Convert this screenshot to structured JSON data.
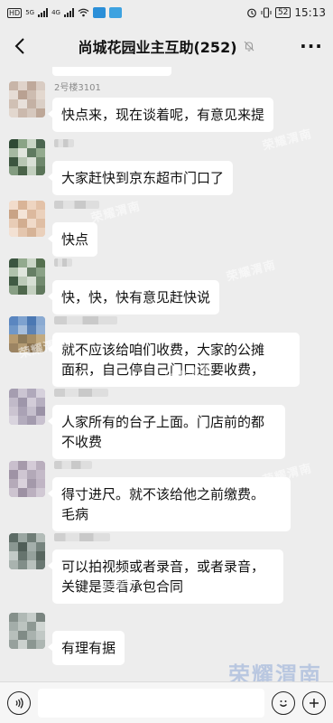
{
  "status_bar": {
    "left_text": "HD",
    "signal_labels": [
      "5G",
      "4G"
    ],
    "time": "15:13",
    "battery": "52"
  },
  "header": {
    "title": "尚城花园业主互助(252)",
    "back_icon": "chevron-left-icon",
    "mute_icon": "bell-off-icon",
    "more_label": "···"
  },
  "messages": [
    {
      "sender": "2号楼3101",
      "text": "快点来，现在谈着呢，有意见来提"
    },
    {
      "sender": "",
      "text": "大家赶快到京东超市门口了"
    },
    {
      "sender": "",
      "text": "快点"
    },
    {
      "sender": "",
      "text": "快，快，快有意见赶快说"
    },
    {
      "sender": "",
      "text": "就不应该给咱们收费，大家的公摊\n面积，自己停自己门口还要收费，"
    },
    {
      "sender": "",
      "text": "人家所有的台子上面。门店前的都\n不收费"
    },
    {
      "sender": "",
      "text": "得寸进尺。就不该给他之前缴费。\n毛病"
    },
    {
      "sender": "",
      "text": "可以拍视频或者录音，或者录音，\n关键是要看承包合同"
    },
    {
      "sender": "",
      "text": "有理有据"
    }
  ],
  "watermark": "荣耀渭南",
  "input_bar": {
    "voice_icon": "voice-icon",
    "emoji_icon": "emoji-icon",
    "plus_icon": "plus-icon",
    "placeholder": ""
  },
  "colors": {
    "background": "#ededed",
    "bubble": "#ffffff",
    "text": "#111111",
    "sender": "#8a8a8a"
  }
}
